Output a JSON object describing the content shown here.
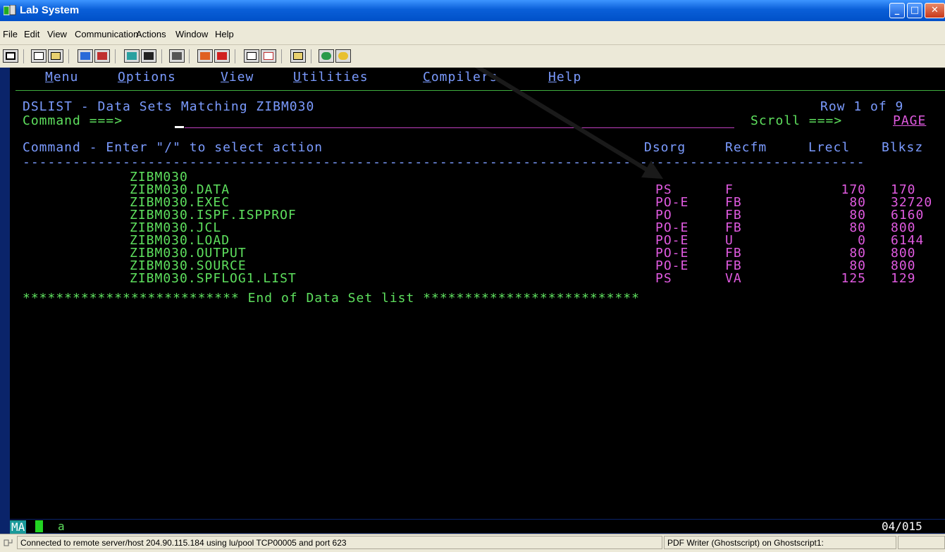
{
  "window": {
    "title": "Lab System",
    "app_icon": "terminal-icon"
  },
  "menubar": [
    "File",
    "Edit",
    "View",
    "Communication",
    "Actions",
    "Window",
    "Help"
  ],
  "toolbar": {
    "icons": [
      "screen-icon",
      "copy-icon",
      "paste-icon",
      "send-icon",
      "receive-icon",
      "display-icon",
      "map-icon",
      "macro-icon",
      "record-icon",
      "play-icon",
      "transfer-up-icon",
      "transfer-down-icon",
      "clipboard-icon",
      "globe-icon",
      "stop-icon"
    ]
  },
  "ispf_menu": [
    {
      "hot": "M",
      "rest": "enu"
    },
    {
      "hot": "O",
      "rest": "ptions"
    },
    {
      "hot": "V",
      "rest": "iew"
    },
    {
      "hot": "U",
      "rest": "tilities"
    },
    {
      "hot": "C",
      "rest": "ompilers"
    },
    {
      "hot": "H",
      "rest": "elp"
    }
  ],
  "panel": {
    "title": "DSLIST - Data Sets Matching ZIBM030",
    "row_info": "Row 1 of 9",
    "command_label": "Command ===>",
    "command_value": "",
    "scroll_label": "Scroll ===>",
    "scroll_value": "PAGE",
    "header_left": "Command - Enter \"/\" to select action",
    "columns": [
      "Dsorg",
      "Recfm",
      "Lrecl",
      "Blksz"
    ],
    "separator": "-----------------------------------------------------------------------------------------------------",
    "end_line": "************************** End of Data Set list **************************"
  },
  "datasets": [
    {
      "name": "ZIBM030",
      "dsorg": "",
      "recfm": "",
      "lrecl": "",
      "blksz": ""
    },
    {
      "name": "ZIBM030.DATA",
      "dsorg": "PS",
      "recfm": "F",
      "lrecl": "170",
      "blksz": "170"
    },
    {
      "name": "ZIBM030.EXEC",
      "dsorg": "PO-E",
      "recfm": "FB",
      "lrecl": "80",
      "blksz": "32720"
    },
    {
      "name": "ZIBM030.ISPF.ISPPROF",
      "dsorg": "PO",
      "recfm": "FB",
      "lrecl": "80",
      "blksz": "6160"
    },
    {
      "name": "ZIBM030.JCL",
      "dsorg": "PO-E",
      "recfm": "FB",
      "lrecl": "80",
      "blksz": "800"
    },
    {
      "name": "ZIBM030.LOAD",
      "dsorg": "PO-E",
      "recfm": "U",
      "lrecl": "0",
      "blksz": "6144"
    },
    {
      "name": "ZIBM030.OUTPUT",
      "dsorg": "PO-E",
      "recfm": "FB",
      "lrecl": "80",
      "blksz": "800"
    },
    {
      "name": "ZIBM030.SOURCE",
      "dsorg": "PO-E",
      "recfm": "FB",
      "lrecl": "80",
      "blksz": "800"
    },
    {
      "name": "ZIBM030.SPFLOG1.LIST",
      "dsorg": "PS",
      "recfm": "VA",
      "lrecl": "125",
      "blksz": "129"
    }
  ],
  "oia": {
    "mode": "MA",
    "input": "a",
    "position": "04/015"
  },
  "status": {
    "connection": "Connected to remote server/host 204.90.115.184 using lu/pool TCP00005 and port 623",
    "printer": "PDF Writer (Ghostscript) on Ghostscript1:"
  }
}
